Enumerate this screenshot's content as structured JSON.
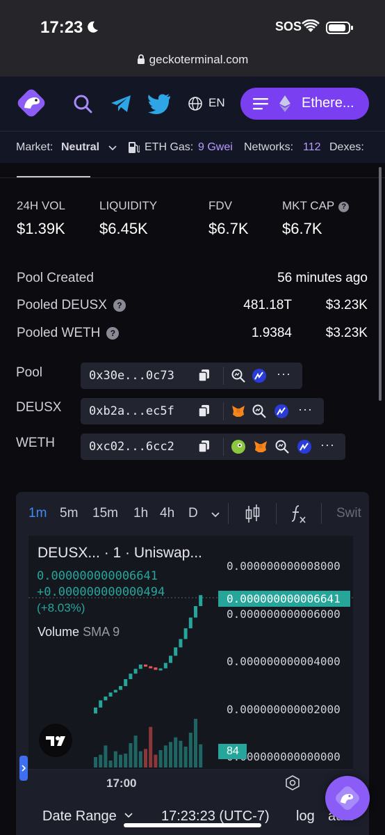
{
  "status_bar": {
    "time": "17:23",
    "sos": "SOS",
    "url": "geckoterminal.com"
  },
  "header": {
    "language": "EN",
    "network_button": "Ethere..."
  },
  "ticker": {
    "market_label": "Market:",
    "market_value": "Neutral",
    "gas_label": "ETH Gas:",
    "gas_value": "9 Gwei",
    "networks_label": "Networks:",
    "networks_value": "112",
    "dexes_label": "Dexes:"
  },
  "stats": [
    {
      "label": "24H VOL",
      "value": "$1.39K"
    },
    {
      "label": "LIQUIDITY",
      "value": "$6.45K"
    },
    {
      "label": "FDV",
      "value": "$6.7K"
    },
    {
      "label": "MKT CAP",
      "value": "$6.7K"
    }
  ],
  "pool_info": {
    "created_label": "Pool Created",
    "created_value": "56 minutes ago",
    "pooled_a_label": "Pooled DEUSX",
    "pooled_a_amount": "481.18T",
    "pooled_a_usd": "$3.23K",
    "pooled_b_label": "Pooled WETH",
    "pooled_b_amount": "1.9384",
    "pooled_b_usd": "$3.23K"
  },
  "addresses": [
    {
      "label": "Pool",
      "address": "0x30e...0c73"
    },
    {
      "label": "DEUSX",
      "address": "0xb2a...ec5f"
    },
    {
      "label": "WETH",
      "address": "0xc02...6cc2"
    }
  ],
  "chart": {
    "intervals": [
      "1m",
      "5m",
      "15m",
      "1h",
      "4h",
      "D"
    ],
    "active_interval": "1m",
    "switch_label": "Swit",
    "pair_title": "DEUSX...  · 1 · Uniswap...",
    "last_price": "0.000000000006641",
    "change_abs": "+0.000000000000494",
    "change_pct": "(+8.03%)",
    "volume_label": "Volume",
    "volume_sma": "SMA 9",
    "price_tag": "0.000000000006641",
    "volume_tag": "84",
    "time_label": "17:00",
    "date_range_label": "Date Range",
    "clock": "17:23:23 (UTC-7)",
    "log_label": "log",
    "auto_label": "auto",
    "colors": {
      "up": "#26a69a",
      "down": "#ef5350"
    }
  },
  "chart_data": {
    "type": "candlestick",
    "title": "DEUSX...  · 1 · Uniswap...",
    "y_ticks": [
      "0.000000000008000",
      "0.000000000006000",
      "0.000000000004000",
      "0.000000000002000",
      "0.000000000000000"
    ],
    "x_ticks": [
      "17:00"
    ],
    "ylim": [
      0,
      8e-12
    ],
    "last_price": 6.641e-12,
    "candles_close": [
      1.93,
      2.23,
      2.39,
      2.56,
      2.67,
      2.83,
      3.12,
      3.35,
      3.55,
      3.73,
      3.66,
      3.61,
      3.51,
      3.57,
      3.8,
      4.1,
      4.45,
      4.8,
      5.25,
      5.7,
      6.18,
      6.64
    ],
    "volume": [
      18,
      22,
      38,
      12,
      28,
      22,
      24,
      42,
      55,
      28,
      32,
      70,
      22,
      30,
      38,
      44,
      52,
      46,
      36,
      60,
      84,
      40
    ]
  }
}
